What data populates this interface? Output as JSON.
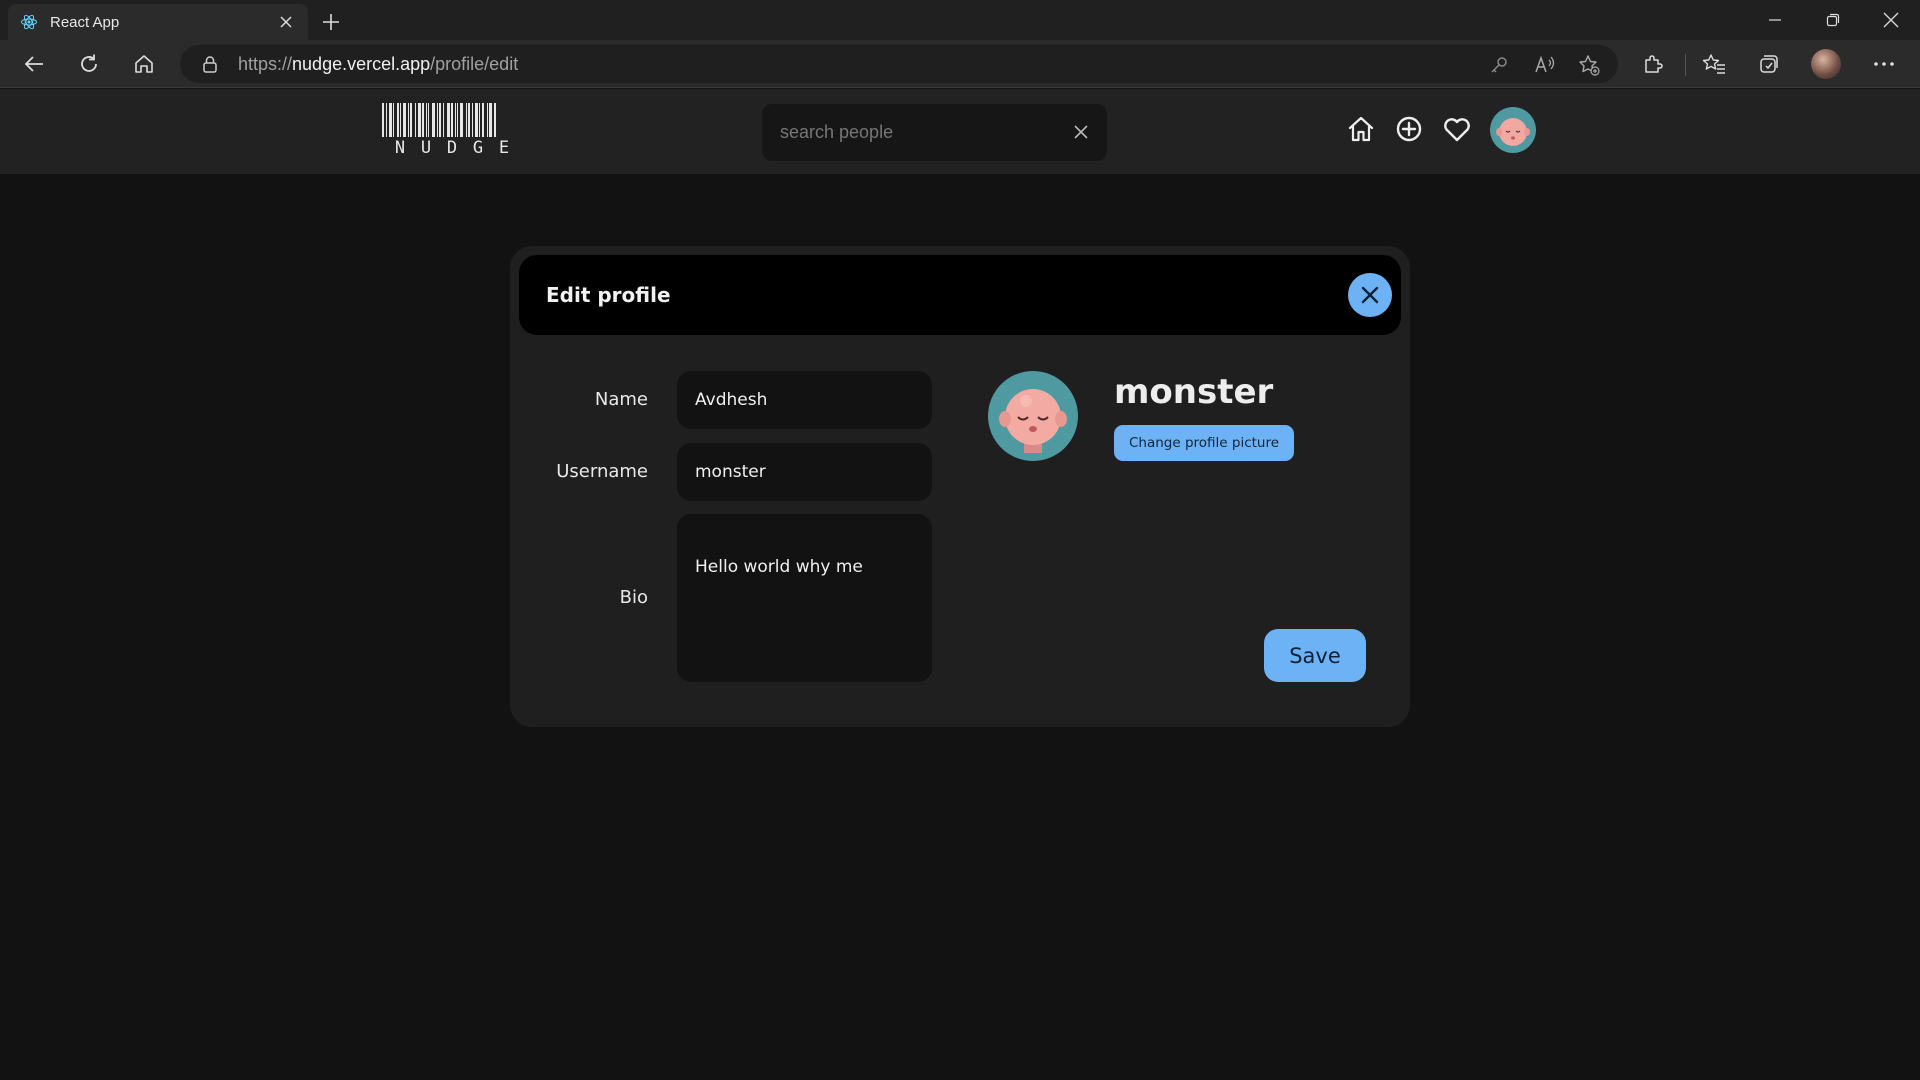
{
  "browser": {
    "tab_title": "React App",
    "url_prefix": "https://",
    "url_host": "nudge.vercel.app",
    "url_path": "/profile/edit"
  },
  "app": {
    "logo_text": "NUDGE",
    "search_placeholder": "search people"
  },
  "modal": {
    "title": "Edit profile",
    "fields": {
      "name_label": "Name",
      "name_value": "Avdhesh",
      "username_label": "Username",
      "username_value": "monster",
      "bio_label": "Bio",
      "bio_value": "Hello world why me"
    },
    "profile": {
      "username": "monster",
      "change_picture_label": "Change profile picture"
    },
    "save_label": "Save"
  },
  "colors": {
    "accent": "#6cb2f5",
    "page_bg": "#121212",
    "modal_bg": "#1f1f1f",
    "header_bg": "#222222"
  },
  "icons": [
    "react-icon",
    "close-icon",
    "plus-icon",
    "back-icon",
    "refresh-icon",
    "home-icon",
    "lock-icon",
    "key-icon",
    "read-aloud-icon",
    "add-favorite-icon",
    "extensions-icon",
    "favorites-icon",
    "collections-icon",
    "more-icon",
    "add-post-icon",
    "heart-icon"
  ]
}
